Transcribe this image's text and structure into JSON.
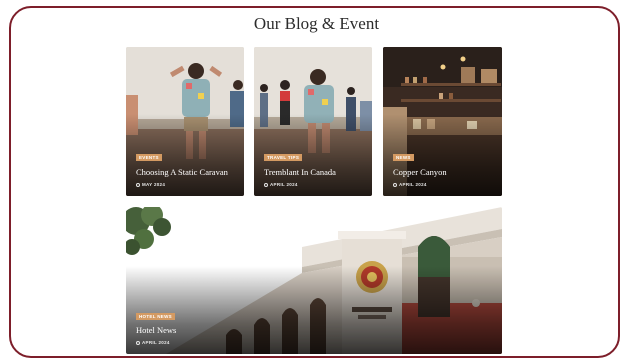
{
  "section_title": "Our Blog & Event",
  "cards": [
    {
      "badge": "EVENTS",
      "title": "Choosing A Static Caravan",
      "date": "MAY 2024",
      "icon": "clock-icon"
    },
    {
      "badge": "TRAVEL TIPS",
      "title": "Tremblant In Canada",
      "date": "APRIL 2024",
      "icon": "clock-icon"
    },
    {
      "badge": "NEWS",
      "title": "Copper Canyon",
      "date": "APRIL 2024",
      "icon": "clock-icon"
    },
    {
      "badge": "HOTEL NEWS",
      "title": "Hotel News",
      "date": "APRIL 2024",
      "icon": "clock-icon"
    }
  ],
  "colors": {
    "frame_border": "#7d1e2a",
    "badge_bg": "#d49a62",
    "title_text": "#2c2c2c"
  }
}
